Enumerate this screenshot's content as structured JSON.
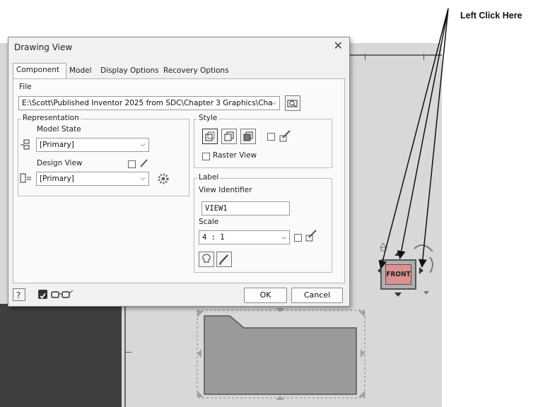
{
  "annotation": {
    "callout": "Left Click Here"
  },
  "dialog": {
    "title": "Drawing View",
    "tabs": [
      {
        "label": "Component",
        "active": true
      },
      {
        "label": "Model",
        "active": false
      },
      {
        "label": "Display Options",
        "active": false
      },
      {
        "label": "Recovery Options",
        "active": false
      }
    ],
    "file_label": "File",
    "file_path": "E:\\Scott\\Published Inventor 2025 from SDC\\Chapter 3 Graphics\\Cha",
    "representation": {
      "title": "Representation",
      "model_state_label": "Model State",
      "model_state_value": "[Primary]",
      "design_view_label": "Design View",
      "design_view_value": "[Primary]"
    },
    "style": {
      "title": "Style",
      "raster_view_label": "Raster View"
    },
    "label_group": {
      "title": "Label",
      "view_identifier_label": "View Identifier",
      "view_identifier_value": "VIEW1",
      "scale_label": "Scale",
      "scale_value": "4 : 1"
    },
    "ok_label": "OK",
    "cancel_label": "Cancel"
  },
  "viewcube": {
    "face_label": "FRONT"
  },
  "colors": {
    "cube_face": "#d99290",
    "part_fill": "#9a9a9a"
  }
}
